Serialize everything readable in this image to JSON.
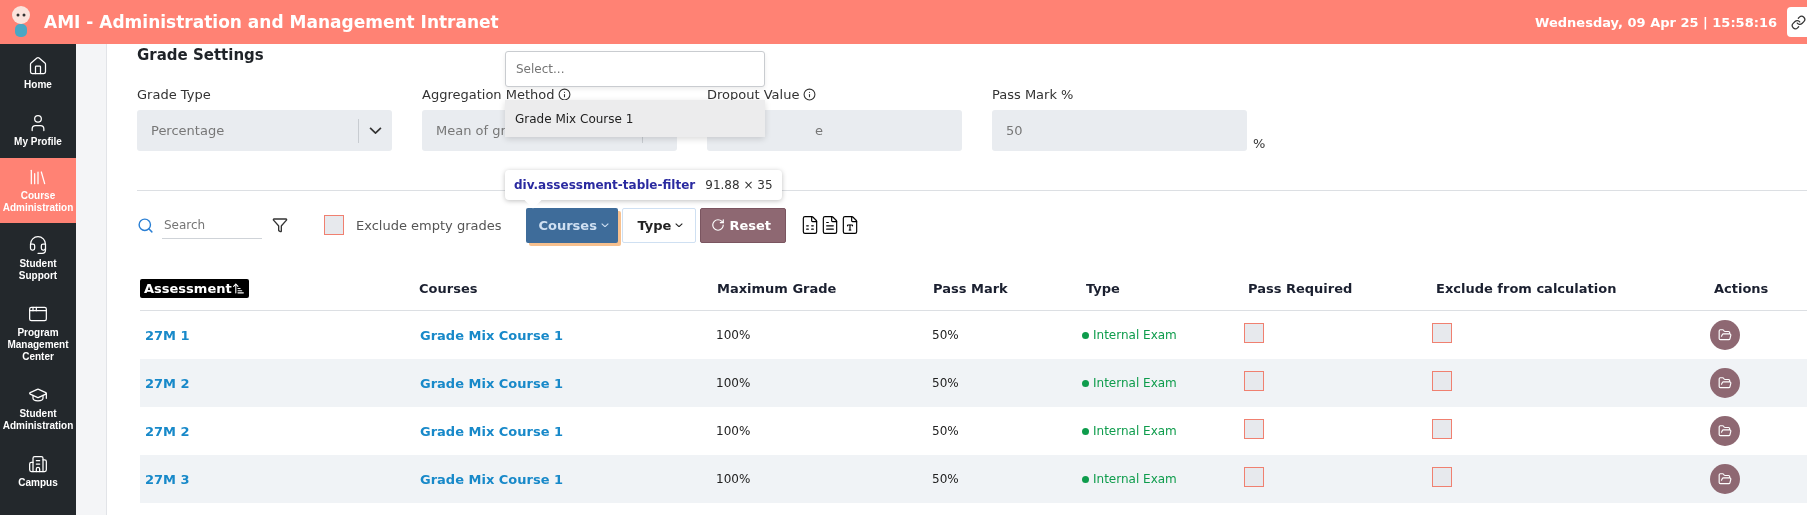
{
  "header": {
    "title": "AMI - Administration and Management Intranet",
    "datetime": "Wednesday, 09 Apr 25 | 15:58:16"
  },
  "sidebar": {
    "items": [
      {
        "label": "Home",
        "selected": false
      },
      {
        "label": "My Profile",
        "selected": false
      },
      {
        "label": "Course Administration",
        "selected": true
      },
      {
        "label": "Student Support",
        "selected": false
      },
      {
        "label": "Program Management Center",
        "selected": false
      },
      {
        "label": "Student Administration",
        "selected": false
      },
      {
        "label": "Campus",
        "selected": false
      }
    ]
  },
  "grade_settings": {
    "title": "Grade Settings",
    "fields": [
      {
        "label": "Grade Type",
        "value": "Percentage",
        "kind": "select",
        "caret": true,
        "info": false
      },
      {
        "label": "Aggregation Method",
        "value": "Mean of gr",
        "kind": "select",
        "caret": false,
        "info": true
      },
      {
        "label": "Dropout Value",
        "value": "e",
        "kind": "text",
        "info": true
      },
      {
        "label": "Pass Mark %",
        "value": "50",
        "kind": "text",
        "info": false,
        "suffix": "%"
      }
    ]
  },
  "dropdown": {
    "placeholder": "Select...",
    "options": [
      {
        "label": "Grade Mix Course 1",
        "selected": true
      }
    ]
  },
  "devtools_tooltip": {
    "selector": "div.assessment-table-filter",
    "size": "91.88 × 35"
  },
  "filters": {
    "search": {
      "placeholder": "Search"
    },
    "exclude_empty": {
      "label": "Exclude empty grades",
      "checked": false
    },
    "buttons": [
      {
        "label": "Courses",
        "kind": "dropdown",
        "selected": true
      },
      {
        "label": "Type",
        "kind": "dropdown",
        "selected": false
      },
      {
        "label": "Reset",
        "kind": "reset"
      }
    ]
  },
  "table": {
    "columns": [
      {
        "label": "Assessment",
        "sorted": true
      },
      {
        "label": "Courses",
        "sorted": false
      },
      {
        "label": "Maximum Grade",
        "sorted": false
      },
      {
        "label": "Pass Mark",
        "sorted": false
      },
      {
        "label": "Type",
        "sorted": false
      },
      {
        "label": "Pass Required",
        "sorted": false
      },
      {
        "label": "Exclude from calculation",
        "sorted": false
      },
      {
        "label": "Actions",
        "sorted": false
      }
    ],
    "rows": [
      {
        "assessment": "27M 1",
        "course": "Grade Mix Course 1",
        "max_grade": "100%",
        "pass_mark": "50%",
        "type": "Internal Exam",
        "pass_required": false,
        "exclude": false
      },
      {
        "assessment": "27M 2",
        "course": "Grade Mix Course 1",
        "max_grade": "100%",
        "pass_mark": "50%",
        "type": "Internal Exam",
        "pass_required": false,
        "exclude": false
      },
      {
        "assessment": "27M 2",
        "course": "Grade Mix Course 1",
        "max_grade": "100%",
        "pass_mark": "50%",
        "type": "Internal Exam",
        "pass_required": false,
        "exclude": false
      },
      {
        "assessment": "27M 3",
        "course": "Grade Mix Course 1",
        "max_grade": "100%",
        "pass_mark": "50%",
        "type": "Internal Exam",
        "pass_required": false,
        "exclude": false
      }
    ]
  }
}
